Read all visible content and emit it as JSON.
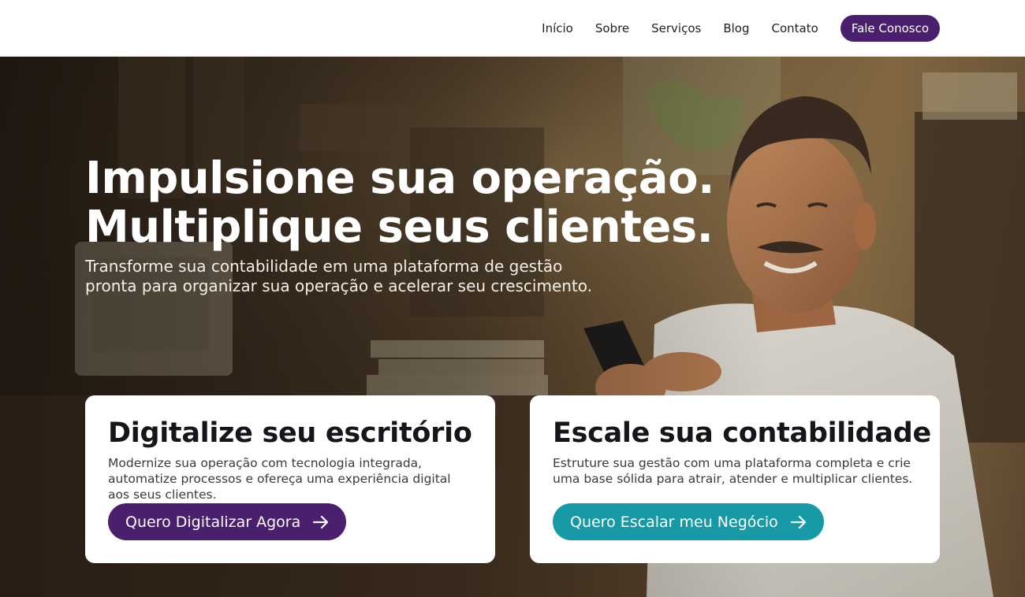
{
  "nav": {
    "links": [
      "Início",
      "Sobre",
      "Serviços",
      "Blog",
      "Contato"
    ],
    "cta_label": "Fale Conosco"
  },
  "hero": {
    "title_line1": "Impulsione sua operação.",
    "title_line2": "Multiplique seus clientes.",
    "subtitle": "Transforme sua contabilidade em uma plataforma de gestão pronta para organizar sua operação e acelerar seu crescimento."
  },
  "cards": [
    {
      "title": "Digitalize seu escritório",
      "text": "Modernize sua operação com tecnologia integrada, automatize processos e ofereça uma experiência digital aos seus clientes.",
      "button_label": "Quero Digitalizar Agora",
      "button_icon": "arrow-right-icon"
    },
    {
      "title": "Escale sua contabilidade",
      "text": "Estruture sua gestão com uma plataforma completa e crie uma base sólida para atrair, atender e multiplicar clientes.",
      "button_label": "Quero Escalar meu Negócio",
      "button_icon": "arrow-right-icon"
    }
  ],
  "colors": {
    "brand_purple": "#4a1f6e",
    "accent_teal": "#179aa6",
    "header_bg": "#ffffff",
    "card_bg": "#ffffff"
  }
}
